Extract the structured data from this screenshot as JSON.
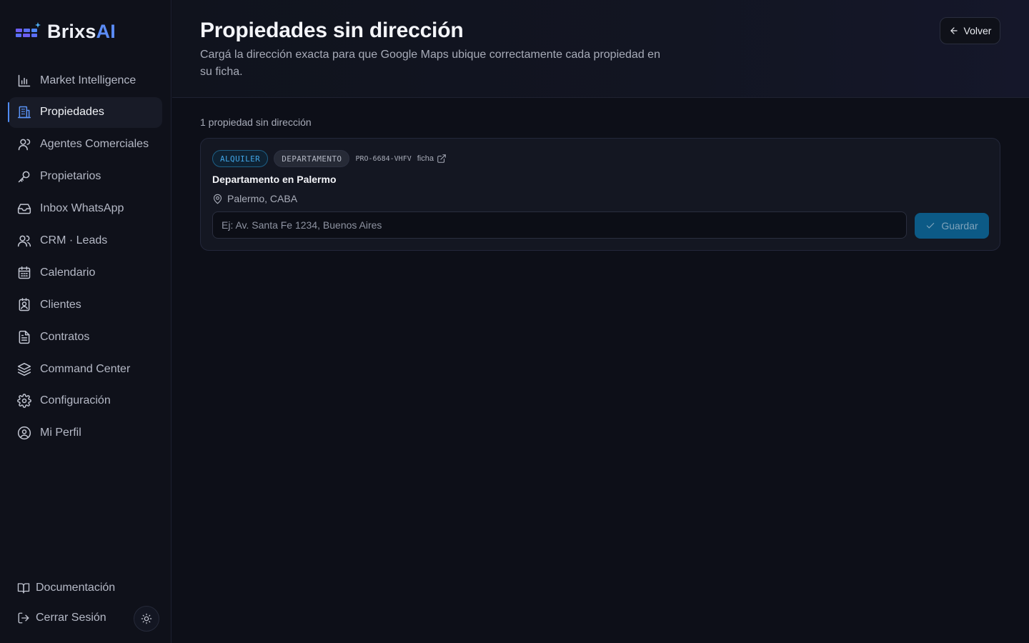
{
  "brand": {
    "name_part1": "Brixs",
    "name_part2": "AI",
    "accent": "#5b8cf6"
  },
  "sidebar": {
    "items": [
      {
        "label": "Market Intelligence",
        "icon": "bar-chart-icon",
        "active": false
      },
      {
        "label": "Propiedades",
        "icon": "building-icon",
        "active": true
      },
      {
        "label": "Agentes Comerciales",
        "icon": "user-icon",
        "active": false
      },
      {
        "label": "Propietarios",
        "icon": "key-icon",
        "active": false
      },
      {
        "label": "Inbox WhatsApp",
        "icon": "inbox-icon",
        "active": false
      },
      {
        "label": "CRM · Leads",
        "icon": "users-icon",
        "active": false
      },
      {
        "label": "Calendario",
        "icon": "calendar-icon",
        "active": false
      },
      {
        "label": "Clientes",
        "icon": "contact-icon",
        "active": false
      },
      {
        "label": "Contratos",
        "icon": "file-text-icon",
        "active": false
      },
      {
        "label": "Command Center",
        "icon": "layers-icon",
        "active": false
      },
      {
        "label": "Configuración",
        "icon": "gear-icon",
        "active": false
      },
      {
        "label": "Mi Perfil",
        "icon": "user-circle-icon",
        "active": false
      }
    ],
    "bottom": {
      "docs_label": "Documentación",
      "logout_label": "Cerrar Sesión"
    }
  },
  "header": {
    "title": "Propiedades sin dirección",
    "subtitle": "Cargá la dirección exacta para que Google Maps ubique correctamente cada propiedad en su ficha.",
    "back_label": "Volver"
  },
  "content": {
    "count_label": "1 propiedad sin dirección",
    "properties": [
      {
        "operation_tag": "ALQUILER",
        "type_tag": "DEPARTAMENTO",
        "code": "PRO-6684-VHFV",
        "ficha_label": "ficha",
        "title": "Departamento en Palermo",
        "location": "Palermo, CABA",
        "address_value": "",
        "address_placeholder": "Ej: Av. Santa Fe 1234, Buenos Aires",
        "save_label": "Guardar"
      }
    ]
  }
}
